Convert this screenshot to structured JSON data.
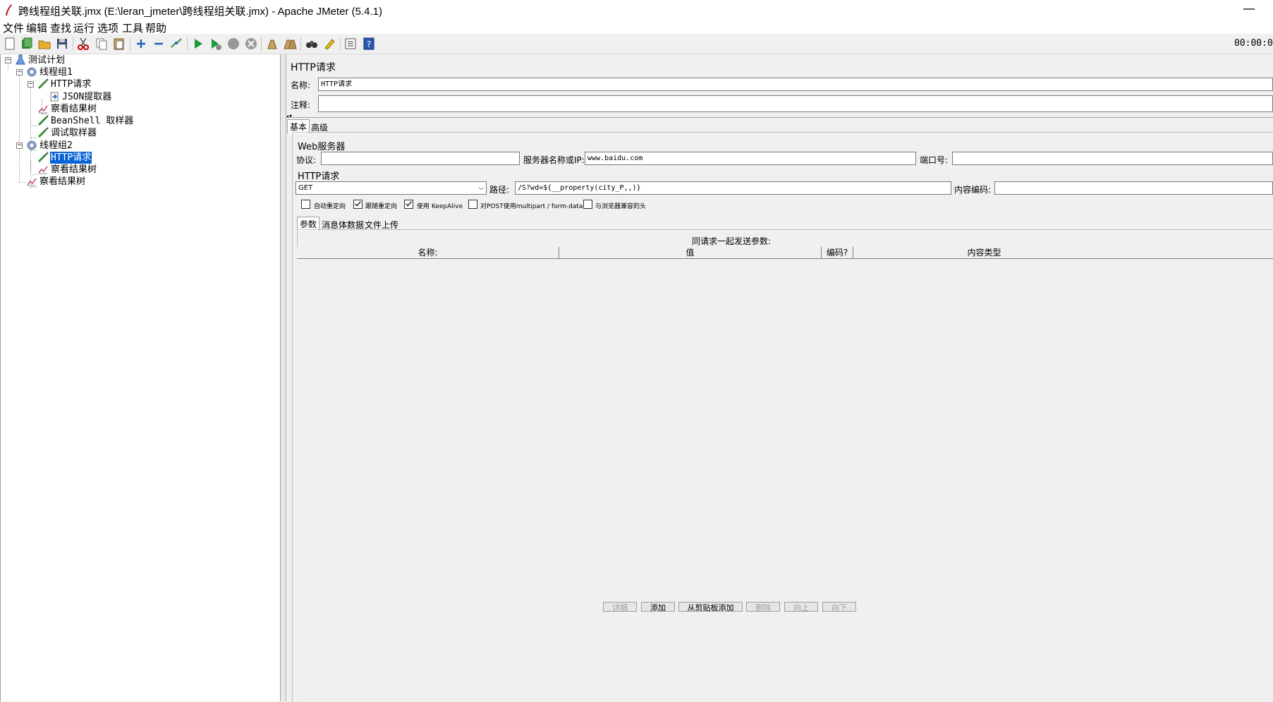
{
  "window": {
    "title": "跨线程组关联.jmx (E:\\leran_jmeter\\跨线程组关联.jmx) - Apache JMeter (5.4.1)",
    "minimize": "—"
  },
  "menu": [
    "文件",
    "编辑",
    "查找",
    "运行",
    "选项",
    "工具",
    "帮助"
  ],
  "toolbar": {
    "icons": [
      "new-icon",
      "templates-icon",
      "open-icon",
      "save-icon",
      "cut-icon",
      "copy-icon",
      "paste-icon",
      "expand-icon",
      "collapse-icon",
      "toggle-icon",
      "start-icon",
      "start-no-timers-icon",
      "stop-icon",
      "shutdown-icon",
      "clear-icon",
      "clear-all-icon",
      "search-icon",
      "reset-search-icon",
      "function-helper-icon",
      "help-icon"
    ],
    "timer": "00:00:0"
  },
  "tree": [
    {
      "label": "测试计划",
      "icon": "test-plan-icon"
    },
    {
      "label": "线程组1",
      "icon": "thread-group-icon"
    },
    {
      "label": "HTTP请求",
      "icon": "sampler-icon"
    },
    {
      "label": "JSON提取器",
      "icon": "extractor-icon"
    },
    {
      "label": "察看结果树",
      "icon": "listener-icon"
    },
    {
      "label": "BeanShell 取样器",
      "icon": "sampler-icon"
    },
    {
      "label": "调试取样器",
      "icon": "sampler-icon"
    },
    {
      "label": "线程组2",
      "icon": "thread-group-icon"
    },
    {
      "label": "HTTP请求",
      "icon": "sampler-icon",
      "selected": true
    },
    {
      "label": "察看结果树",
      "icon": "listener-icon"
    },
    {
      "label": "察看结果树",
      "icon": "listener-icon"
    }
  ],
  "panel": {
    "title": "HTTP请求",
    "name_label": "名称:",
    "name_value": "HTTP请求",
    "comment_label": "注释:",
    "comment_value": "",
    "tabs": [
      "基本",
      "高级"
    ],
    "web_server": {
      "section": "Web服务器",
      "protocol_label": "协议:",
      "protocol_value": "",
      "server_label": "服务器名称或IP:",
      "server_value": "www.baidu.com",
      "port_label": "端口号:",
      "port_value": ""
    },
    "http_request": {
      "section": "HTTP请求",
      "method": "GET",
      "path_label": "路径:",
      "path_value": "/S?wd=${__property(city_P,,)}",
      "encoding_label": "内容编码:",
      "encoding_value": ""
    },
    "checkboxes": [
      {
        "label": "自动重定向",
        "checked": false
      },
      {
        "label": "跟随重定向",
        "checked": true
      },
      {
        "label": "使用 KeepAlive",
        "checked": true
      },
      {
        "label": "对POST使用multipart / form-data",
        "checked": false
      },
      {
        "label": "与浏览器兼容的头",
        "checked": false
      }
    ],
    "subtabs": [
      "参数",
      "消息体数据",
      "文件上传"
    ],
    "params_title": "同请求一起发送参数:",
    "columns": [
      "名称:",
      "值",
      "编码?",
      "内容类型"
    ],
    "buttons": [
      {
        "label": "详细",
        "enabled": false
      },
      {
        "label": "添加",
        "enabled": true
      },
      {
        "label": "从剪贴板添加",
        "enabled": true
      },
      {
        "label": "删除",
        "enabled": false
      },
      {
        "label": "向上",
        "enabled": false
      },
      {
        "label": "向下",
        "enabled": false
      }
    ]
  }
}
